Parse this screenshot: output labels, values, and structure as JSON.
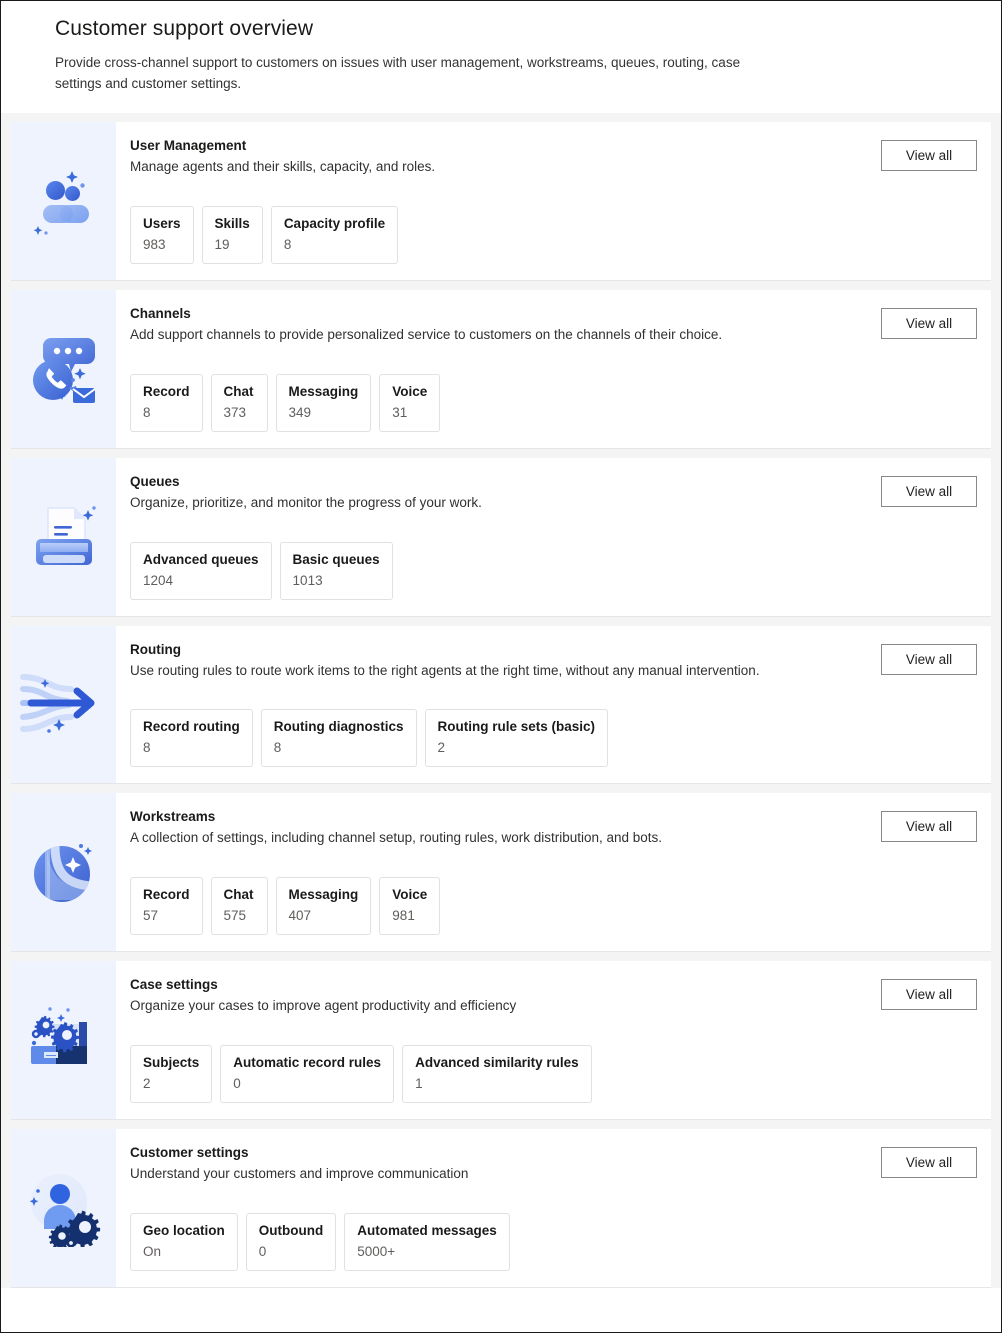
{
  "header": {
    "title": "Customer support overview",
    "subtitle": "Provide cross-channel support to customers on issues with user management, workstreams, queues, routing, case settings and customer settings."
  },
  "common": {
    "view_all_label": "View all"
  },
  "colors": {
    "icon_panel_bg": "#eef3fd",
    "accent_blue": "#3b6bdb",
    "accent_blue_light": "#9cb6f0",
    "accent_blue_dark": "#1f3c88",
    "page_bg": "#f4f4f4",
    "card_bg": "#ffffff",
    "tile_border": "#e1e1e1",
    "button_border": "#8a8886",
    "title_text": "#1b1a19",
    "value_text": "#605e5c"
  },
  "cards": [
    {
      "icon": "people-icon",
      "title": "User Management",
      "description": "Manage agents and their skills, capacity, and roles.",
      "view_all_label": "View all",
      "stats": [
        {
          "label": "Users",
          "value": "983"
        },
        {
          "label": "Skills",
          "value": "19"
        },
        {
          "label": "Capacity profile",
          "value": "8"
        }
      ]
    },
    {
      "icon": "chat-bubbles-icon",
      "title": "Channels",
      "description": "Add support channels to provide personalized service to customers on the channels of their choice.",
      "view_all_label": "View all",
      "stats": [
        {
          "label": "Record",
          "value": "8"
        },
        {
          "label": "Chat",
          "value": "373"
        },
        {
          "label": "Messaging",
          "value": "349"
        },
        {
          "label": "Voice",
          "value": "31"
        }
      ]
    },
    {
      "icon": "document-tray-icon",
      "title": "Queues",
      "description": "Organize, prioritize, and monitor the progress of your work.",
      "view_all_label": "View all",
      "stats": [
        {
          "label": "Advanced queues",
          "value": "1204"
        },
        {
          "label": "Basic queues",
          "value": "1013"
        }
      ]
    },
    {
      "icon": "routing-arrow-icon",
      "title": "Routing",
      "description": "Use routing rules to route work items to the right agents at the right time, without any manual intervention.",
      "view_all_label": "View all",
      "stats": [
        {
          "label": "Record routing",
          "value": "8"
        },
        {
          "label": "Routing diagnostics",
          "value": "8"
        },
        {
          "label": "Routing rule sets (basic)",
          "value": "2"
        }
      ]
    },
    {
      "icon": "workstream-sphere-icon",
      "title": "Workstreams",
      "description": "A collection of settings, including channel setup, routing rules, work distribution, and bots.",
      "view_all_label": "View all",
      "stats": [
        {
          "label": "Record",
          "value": "57"
        },
        {
          "label": "Chat",
          "value": "575"
        },
        {
          "label": "Messaging",
          "value": "407"
        },
        {
          "label": "Voice",
          "value": "981"
        }
      ]
    },
    {
      "icon": "briefcase-gears-icon",
      "title": "Case settings",
      "description": "Organize your cases to improve agent productivity and efficiency",
      "view_all_label": "View all",
      "stats": [
        {
          "label": "Subjects",
          "value": "2"
        },
        {
          "label": "Automatic record rules",
          "value": "0"
        },
        {
          "label": "Advanced similarity rules",
          "value": "1"
        }
      ]
    },
    {
      "icon": "person-gears-icon",
      "title": "Customer settings",
      "description": "Understand your customers and improve communication",
      "view_all_label": "View all",
      "stats": [
        {
          "label": "Geo location",
          "value": "On"
        },
        {
          "label": "Outbound",
          "value": "0"
        },
        {
          "label": "Automated messages",
          "value": "5000+"
        }
      ]
    }
  ]
}
